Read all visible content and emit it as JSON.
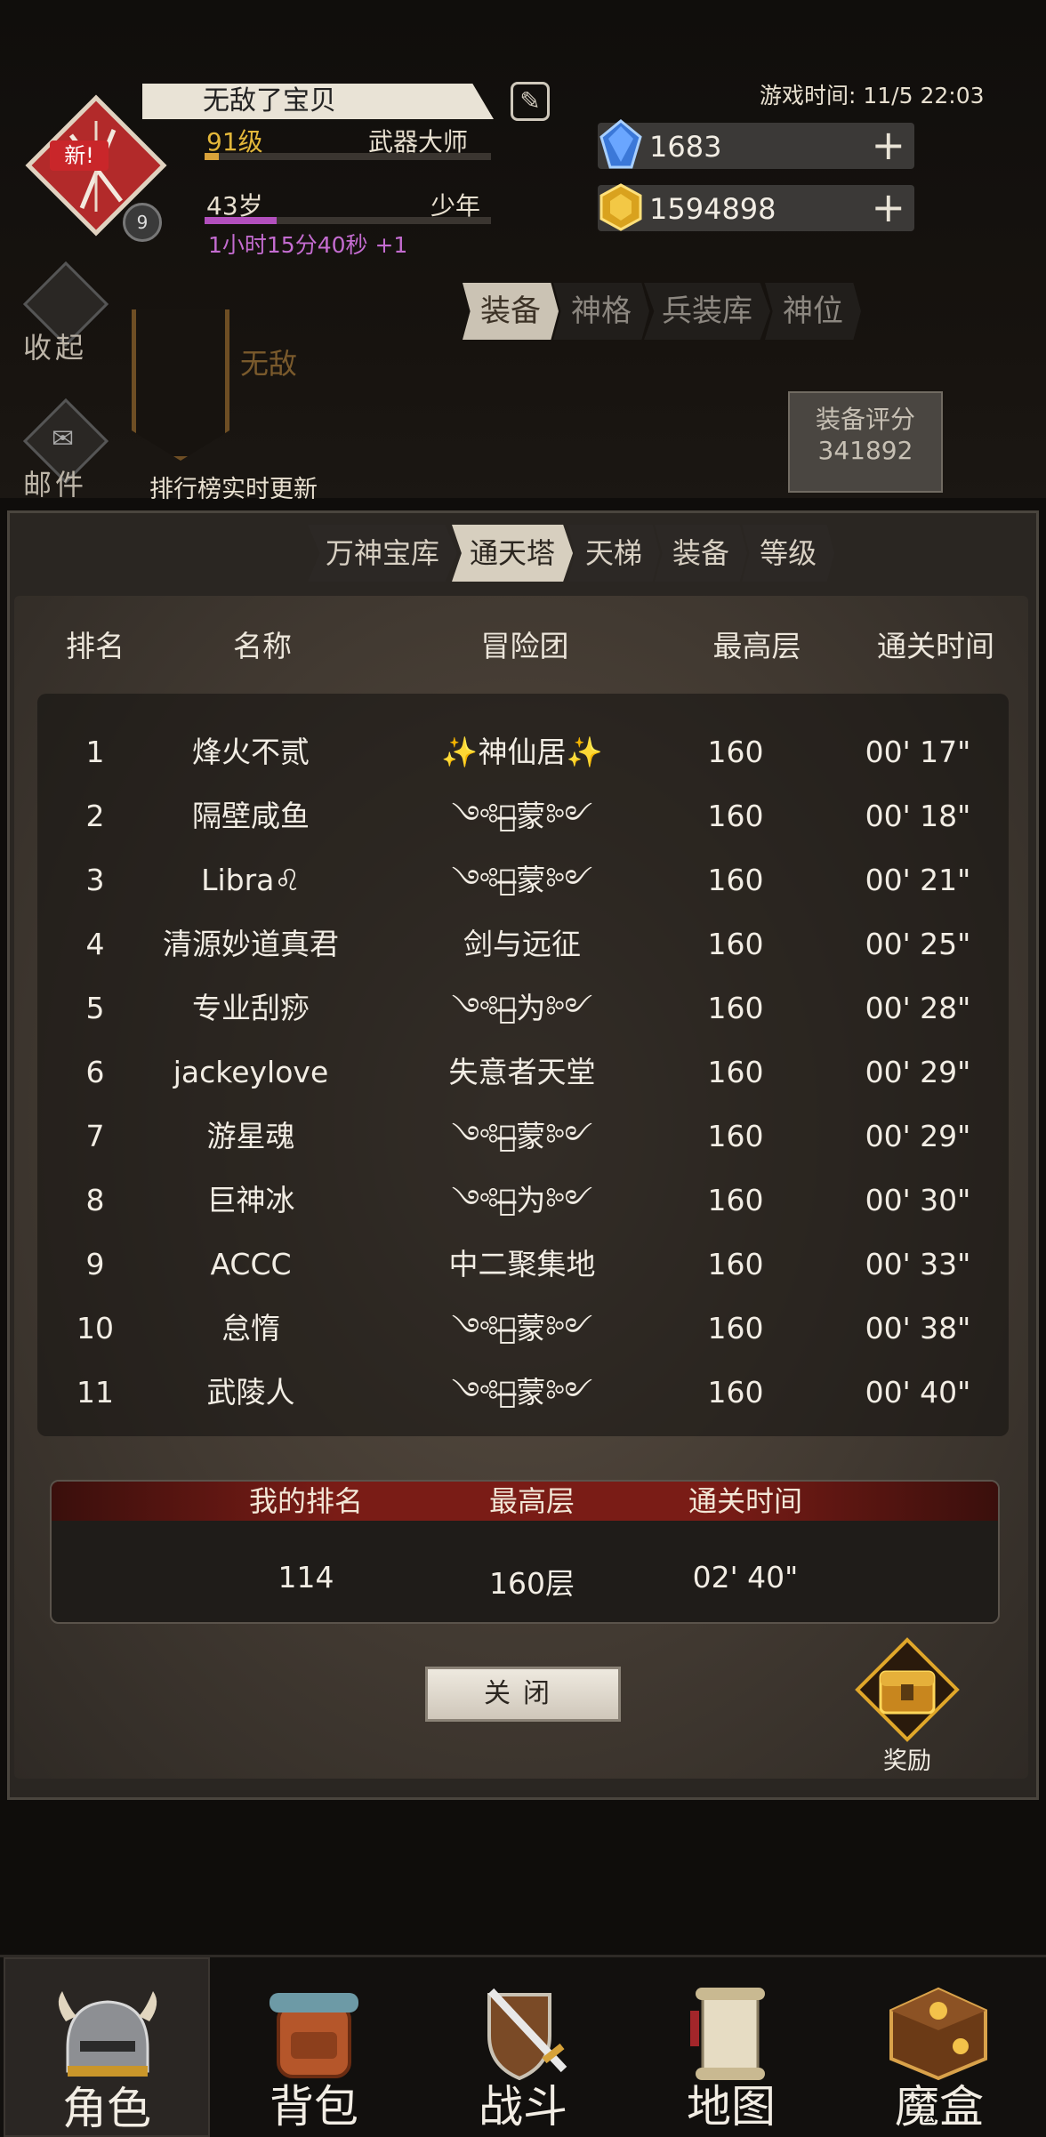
{
  "player": {
    "name": "无敌了宝贝",
    "level": "91级",
    "title": "武器大师",
    "age": "43岁",
    "stage": "少年",
    "age_timer": "1小时15分40秒 +1",
    "badge_new": "新!",
    "badge_level": "9"
  },
  "game_time": "游戏时间: 11/5 22:03",
  "resources": {
    "gems": "1683",
    "gold": "1594898"
  },
  "side_buttons": {
    "collapse": "收起",
    "mail": "邮件"
  },
  "banner_name": "无敌",
  "rank_note": "排行榜实时更新",
  "top_tabs": [
    "装备",
    "神格",
    "兵装库",
    "神位"
  ],
  "equip_score": {
    "label": "装备评分",
    "value": "341892"
  },
  "rank_tabs": [
    "万神宝库",
    "通天塔",
    "天梯",
    "装备",
    "等级"
  ],
  "table": {
    "headers": [
      "排名",
      "名称",
      "冒险团",
      "最高层",
      "通关时间"
    ],
    "rows": [
      {
        "rank": "1",
        "name": "烽火不贰",
        "team": "✨神仙居✨",
        "floor": "160",
        "time": "00' 17\""
      },
      {
        "rank": "2",
        "name": "隔壁咸鱼",
        "team": "༺鸿̶̶̶蒙༻",
        "floor": "160",
        "time": "00' 18\""
      },
      {
        "rank": "3",
        "name": "Libra♌",
        "team": "༺鸿̶̶̶蒙༻",
        "floor": "160",
        "time": "00' 21\""
      },
      {
        "rank": "4",
        "name": "清源妙道真君",
        "team": "剑与远征",
        "floor": "160",
        "time": "00' 25\""
      },
      {
        "rank": "5",
        "name": "专业刮痧",
        "team": "༺华̶̶̶为༻",
        "floor": "160",
        "time": "00' 28\""
      },
      {
        "rank": "6",
        "name": "jackeylove",
        "team": "失意者天堂",
        "floor": "160",
        "time": "00' 29\""
      },
      {
        "rank": "7",
        "name": "游星魂",
        "team": "༺鸿̶̶̶蒙༻",
        "floor": "160",
        "time": "00' 29\""
      },
      {
        "rank": "8",
        "name": "巨神冰",
        "team": "༺华̶̶̶为༻",
        "floor": "160",
        "time": "00' 30\""
      },
      {
        "rank": "9",
        "name": "ACCC",
        "team": "中二聚集地",
        "floor": "160",
        "time": "00' 33\""
      },
      {
        "rank": "10",
        "name": "怠惰",
        "team": "༺鸿̶̶̶蒙༻",
        "floor": "160",
        "time": "00' 38\""
      },
      {
        "rank": "11",
        "name": "武陵人",
        "team": "༺鸿̶̶̶蒙༻",
        "floor": "160",
        "time": "00' 40\""
      }
    ]
  },
  "my_rank": {
    "headers": [
      "我的排名",
      "最高层",
      "通关时间"
    ],
    "rank": "114",
    "floor": "160层",
    "time": "02' 40\""
  },
  "close_label": "关闭",
  "reward_label": "奖励",
  "nav": [
    "角色",
    "背包",
    "战斗",
    "地图",
    "魔盒"
  ],
  "colors": {
    "accent_gold": "#e3b73a",
    "age_purple": "#b24fbd",
    "my_rank_red": "#7a1c16"
  }
}
